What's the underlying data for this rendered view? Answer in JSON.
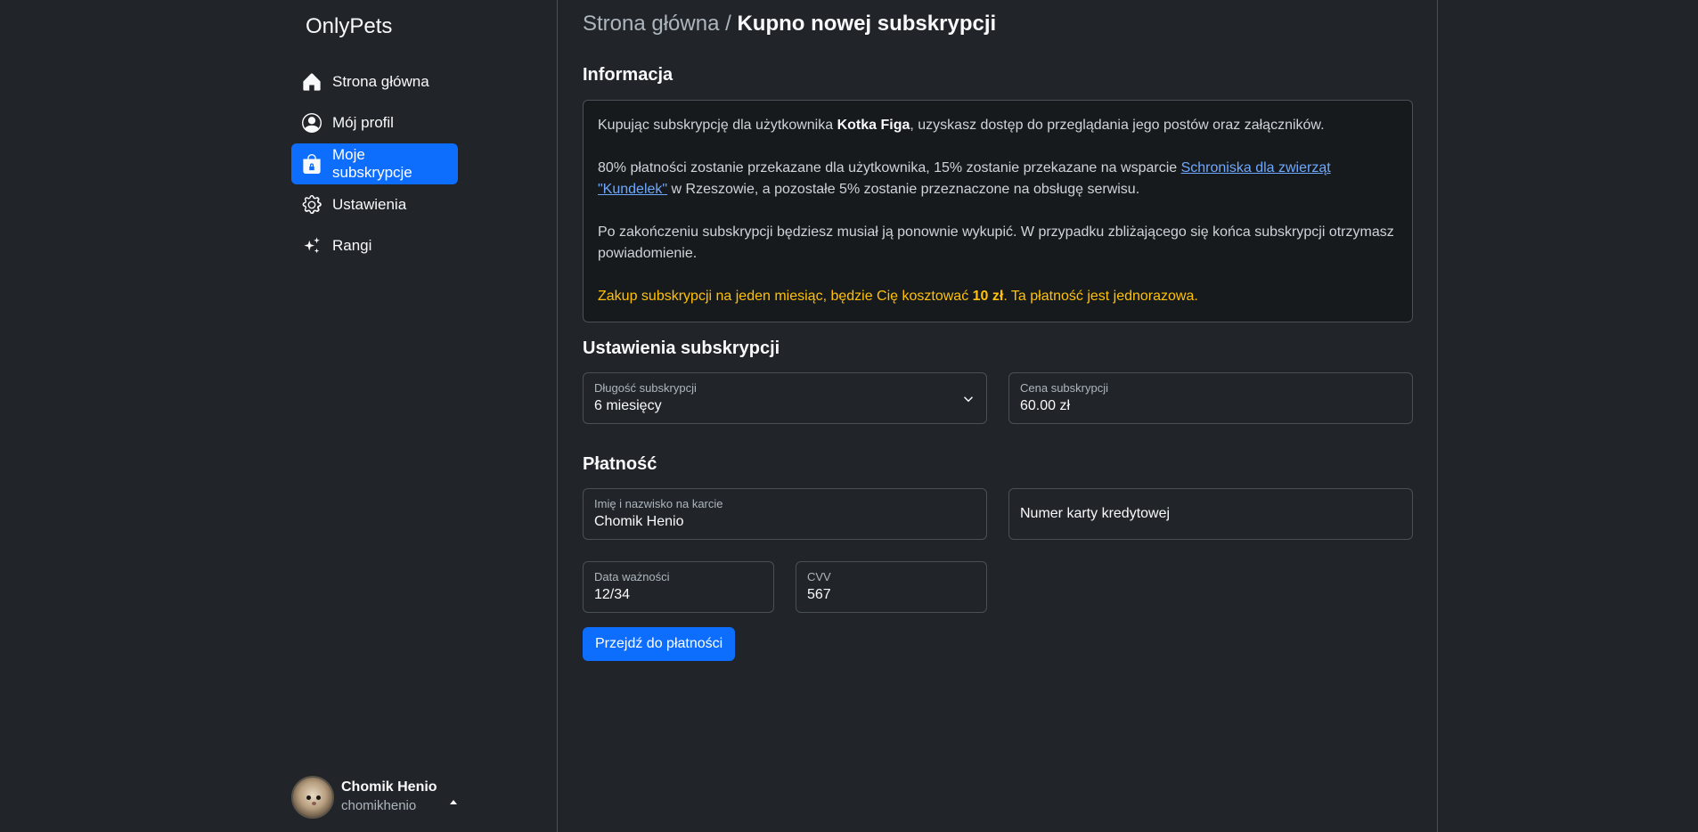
{
  "brand": "OnlyPets",
  "nav": {
    "items": [
      {
        "label": "Strona główna",
        "icon": "home-icon"
      },
      {
        "label": "Mój profil",
        "icon": "user-circle-icon"
      },
      {
        "label": "Moje subskrypcje",
        "icon": "bag-lock-icon",
        "active": true
      },
      {
        "label": "Ustawienia",
        "icon": "gear-icon"
      },
      {
        "label": "Rangi",
        "icon": "sparkles-icon"
      }
    ]
  },
  "user": {
    "name": "Chomik Henio",
    "handle": "chomikhenio"
  },
  "breadcrumb": {
    "home": "Strona główna",
    "separator": "/",
    "current": "Kupno nowej subskrypcji"
  },
  "info": {
    "heading": "Informacja",
    "p1_a": "Kupując subskrypcję dla użytkownika ",
    "p1_user": "Kotka Figa",
    "p1_b": ", uzyskasz dostęp do przeglądania jego postów oraz załączników.",
    "p2_a": "80% płatności zostanie przekazane dla użytkownika, 15% zostanie przekazane na wsparcie ",
    "p2_link": "Schroniska dla zwierząt \"Kundelek\"",
    "p2_b": " w Rzeszowie, a pozostałe 5% zostanie przeznaczone na obsługę serwisu.",
    "p3": "Po zakończeniu subskrypcji będziesz musiał ją ponownie wykupić. W przypadku zbliżającego się końca subskrypcji otrzymasz powiadomienie.",
    "p4_a": "Zakup subskrypcji na jeden miesiąc, będzie Cię kosztować ",
    "p4_price": "10 zł",
    "p4_b": ". Ta płatność jest jednorazowa."
  },
  "settings": {
    "heading": "Ustawienia subskrypcji",
    "length_label": "Długość subskrypcji",
    "length_value": "6 miesięcy",
    "price_label": "Cena subskrypcji",
    "price_value": "60.00 zł"
  },
  "payment": {
    "heading": "Płatność",
    "name_label": "Imię i nazwisko na karcie",
    "name_value": "Chomik Henio",
    "card_placeholder": "Numer karty kredytowej",
    "expiry_label": "Data ważności",
    "expiry_value": "12/34",
    "cvv_label": "CVV",
    "cvv_value": "567",
    "submit_label": "Przejdź do płatności"
  },
  "colors": {
    "accent": "#0d6efd",
    "warning": "#ffc107",
    "link": "#6ea8fe"
  }
}
